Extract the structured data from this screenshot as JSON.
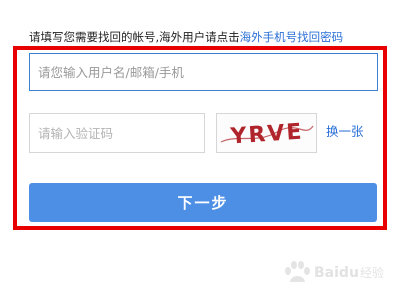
{
  "instruction": {
    "text": "请填写您需要找回的帐号,海外用户请点击",
    "link": "海外手机号找回密码"
  },
  "username": {
    "placeholder": "请您输入用户名/邮箱/手机",
    "value": ""
  },
  "captcha": {
    "placeholder": "请输入验证码",
    "value": "",
    "image_text": "YRVE",
    "refresh_label": "换一张"
  },
  "next_button": {
    "label": "下一步"
  },
  "watermark": {
    "text": "Baidu 经验"
  },
  "colors": {
    "accent": "#4e8fe6",
    "link": "#2a6fd6",
    "highlight_frame": "#e80000",
    "captcha_text": "#b0242b"
  }
}
